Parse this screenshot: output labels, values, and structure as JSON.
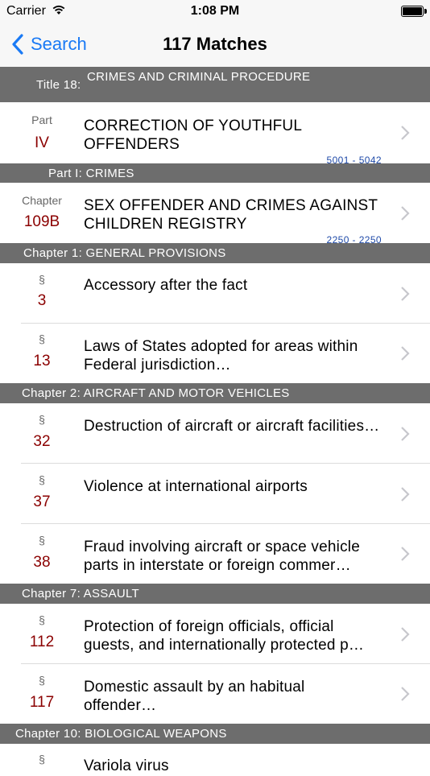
{
  "status_bar": {
    "carrier": "Carrier",
    "time": "1:08 PM"
  },
  "nav": {
    "back_label": "Search",
    "title": "117 Matches"
  },
  "list": {
    "title_header": {
      "prefix": "Title 18:",
      "title": "CRIMES AND CRIMINAL PROCEDURE"
    },
    "part_row": {
      "kind": "Part",
      "num": "IV",
      "text": "CORRECTION OF YOUTHFUL OFFENDERS",
      "range": "5001 - 5042"
    },
    "part_header": {
      "title": "Part I: CRIMES"
    },
    "chapter_row": {
      "kind": "Chapter",
      "num": "109B",
      "text": "SEX OFFENDER AND CRIMES AGAINST CHILDREN REGISTRY",
      "range": "2250 - 2250"
    },
    "ch1_header": {
      "title": "Chapter 1: GENERAL PROVISIONS"
    },
    "sec3": {
      "kind": "§",
      "num": "3",
      "text": "Accessory after the fact"
    },
    "sec13": {
      "kind": "§",
      "num": "13",
      "text": "Laws of States adopted for areas within Federal jurisdiction…"
    },
    "ch2_header": {
      "title": "Chapter 2: AIRCRAFT AND MOTOR VEHICLES"
    },
    "sec32": {
      "kind": "§",
      "num": "32",
      "text": "Destruction of aircraft or aircraft facilities…"
    },
    "sec37": {
      "kind": "§",
      "num": "37",
      "text": "Violence at international airports"
    },
    "sec38": {
      "kind": "§",
      "num": "38",
      "text": "Fraud involving aircraft or space vehicle parts in interstate or foreign commer…"
    },
    "ch7_header": {
      "title": "Chapter 7: ASSAULT"
    },
    "sec112": {
      "kind": "§",
      "num": "112",
      "text": "Protection of foreign officials, official guests, and internationally protected p…"
    },
    "sec117": {
      "kind": "§",
      "num": "117",
      "text": "Domestic assault by an habitual offender…"
    },
    "ch10_header": {
      "title": "Chapter 10: BIOLOGICAL WEAPONS"
    },
    "sec_partial": {
      "kind": "§",
      "text": "Variola virus"
    }
  }
}
